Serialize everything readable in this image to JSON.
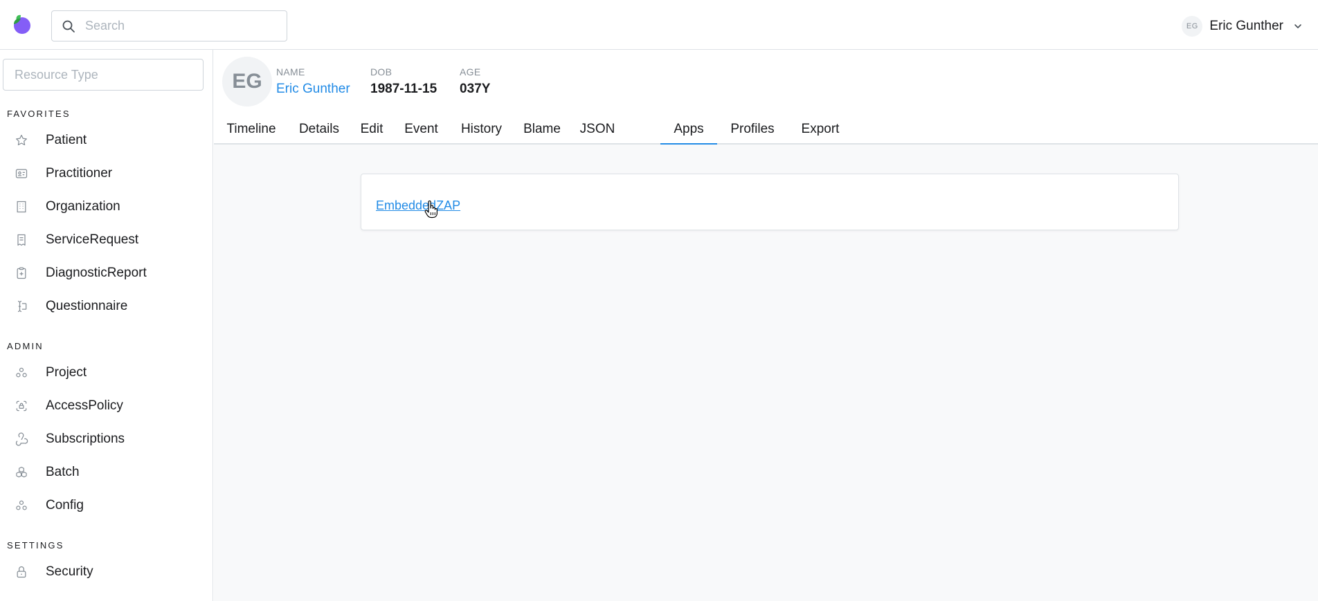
{
  "header": {
    "search_placeholder": "Search",
    "user": {
      "initials": "EG",
      "name": "Eric Gunther"
    }
  },
  "sidebar": {
    "resource_type_placeholder": "Resource Type",
    "favorites_title": "FAVORITES",
    "favorites": [
      {
        "label": "Patient",
        "icon": "star-icon"
      },
      {
        "label": "Practitioner",
        "icon": "id-badge-icon"
      },
      {
        "label": "Organization",
        "icon": "building-icon"
      },
      {
        "label": "ServiceRequest",
        "icon": "receipt-icon"
      },
      {
        "label": "DiagnosticReport",
        "icon": "report-medical-icon"
      },
      {
        "label": "Questionnaire",
        "icon": "forms-icon"
      }
    ],
    "admin_title": "ADMIN",
    "admin": [
      {
        "label": "Project",
        "icon": "brand-asana-icon"
      },
      {
        "label": "AccessPolicy",
        "icon": "lock-access-icon"
      },
      {
        "label": "Subscriptions",
        "icon": "webhook-icon"
      },
      {
        "label": "Batch",
        "icon": "boxes-icon"
      },
      {
        "label": "Config",
        "icon": "brand-asana-icon"
      }
    ],
    "settings_title": "SETTINGS",
    "settings": [
      {
        "label": "Security",
        "icon": "lock-icon"
      }
    ]
  },
  "patient": {
    "initials": "EG",
    "name_label": "NAME",
    "name": "Eric Gunther",
    "dob_label": "DOB",
    "dob": "1987-11-15",
    "age_label": "AGE",
    "age": "037Y"
  },
  "tabs": [
    "Timeline",
    "Details",
    "Edit",
    "Event",
    "History",
    "Blame",
    "JSON",
    "Apps",
    "Profiles",
    "Export"
  ],
  "active_tab": "Apps",
  "apps": {
    "link_label": "EmbeddedZAP"
  },
  "colors": {
    "accent": "#228be6",
    "border": "#dee2e6",
    "background": "#f8f9fa"
  }
}
